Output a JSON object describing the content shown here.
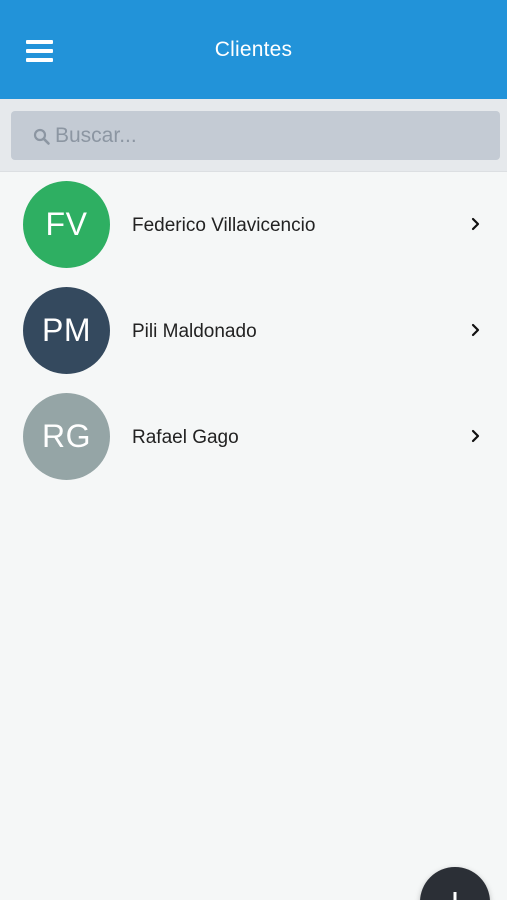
{
  "header": {
    "title": "Clientes",
    "background_color": "#2293d9",
    "menu_icon": "hamburger-menu-icon"
  },
  "search": {
    "placeholder": "Buscar...",
    "value": "",
    "icon": "search-icon"
  },
  "clients": [
    {
      "initials": "FV",
      "name": "Federico Villavicencio",
      "avatar_color": "#2eaf62"
    },
    {
      "initials": "PM",
      "name": "Pili Maldonado",
      "avatar_color": "#34495e"
    },
    {
      "initials": "RG",
      "name": "Rafael Gago",
      "avatar_color": "#95a5a6"
    }
  ],
  "fab": {
    "icon": "plus-icon",
    "color": "#2b2f36"
  }
}
